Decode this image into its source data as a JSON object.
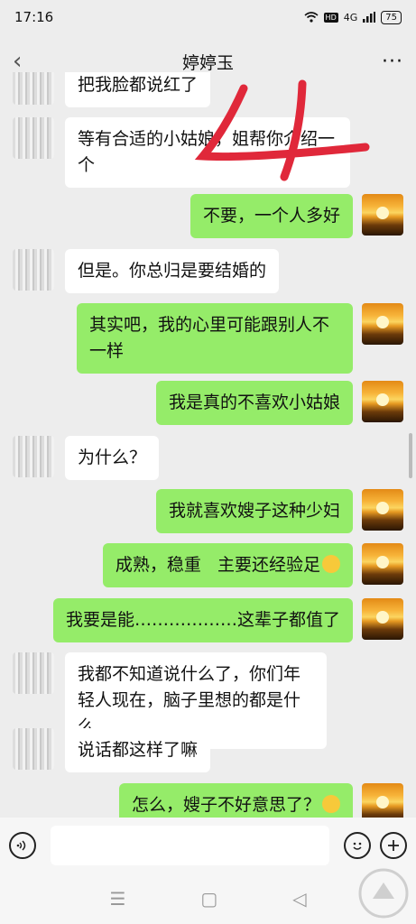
{
  "status_bar": {
    "time": "17:16",
    "hd": "HD",
    "network": "4G",
    "battery": "75"
  },
  "nav": {
    "back_icon": "‹",
    "title": "婷婷玉",
    "more_icon": "···"
  },
  "messages": [
    {
      "side": "left",
      "text": "把我脸都说红了"
    },
    {
      "side": "left",
      "text": "等有合适的小姑娘，姐帮你介绍一个"
    },
    {
      "side": "right",
      "text": "不要，一个人多好"
    },
    {
      "side": "left",
      "text": "但是。你总归是要结婚的"
    },
    {
      "side": "right",
      "text": "其实吧，我的心里可能跟别人不一样"
    },
    {
      "side": "right",
      "text": "我是真的不喜欢小姑娘"
    },
    {
      "side": "left",
      "text": "为什么？"
    },
    {
      "side": "right",
      "text": "我就喜欢嫂子这种少妇"
    },
    {
      "side": "right",
      "text": "成熟，稳重   主要还经验足"
    },
    {
      "side": "right",
      "text": "我要是能………………这辈子都值了"
    },
    {
      "side": "left",
      "text": "我都不知道说什么了，你们年轻人现在，脑子里想的都是什么"
    },
    {
      "side": "left",
      "text": "说话都这样了嘛"
    },
    {
      "side": "right",
      "text": "怎么，嫂子不好意思了？"
    }
  ],
  "icons": {
    "voice": "voice-icon",
    "emoji": "emoji-icon",
    "add": "add-icon",
    "smile": "smile-emoji-icon",
    "nav_menu": "☰",
    "nav_home": "▢",
    "nav_back": "◁"
  },
  "colors": {
    "green_bubble": "#95ec69",
    "white_bubble": "#ffffff",
    "background": "#ededed",
    "handwriting": "#e0283a"
  }
}
